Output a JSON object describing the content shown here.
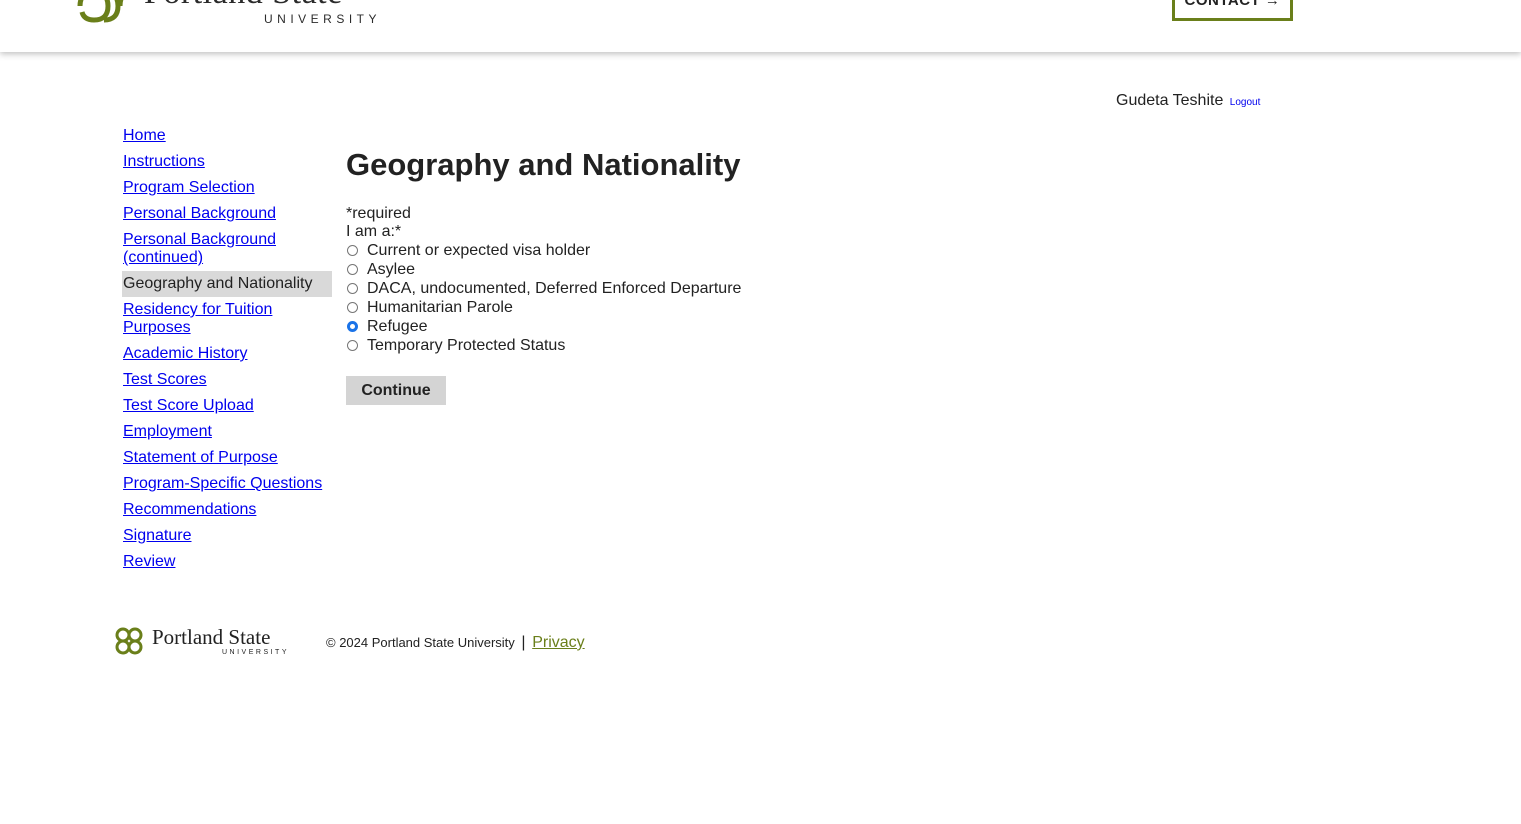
{
  "header": {
    "logo_name": "Portland State",
    "logo_sub": "UNIVERSITY",
    "contact_label": "CONTACT →"
  },
  "user": {
    "name": "Gudeta Teshite",
    "logout_label": "Logout"
  },
  "sidenav": {
    "items": [
      {
        "label": "Home"
      },
      {
        "label": "Instructions"
      },
      {
        "label": "Program Selection"
      },
      {
        "label": "Personal Background"
      },
      {
        "label": "Personal Background (continued)"
      },
      {
        "label": "Geography and Nationality",
        "current": true
      },
      {
        "label": "Residency for Tuition Purposes"
      },
      {
        "label": "Academic History"
      },
      {
        "label": "Test Scores"
      },
      {
        "label": "Test Score Upload"
      },
      {
        "label": "Employment"
      },
      {
        "label": "Statement of Purpose"
      },
      {
        "label": "Program-Specific Questions"
      },
      {
        "label": "Recommendations"
      },
      {
        "label": "Signature"
      },
      {
        "label": "Review"
      }
    ]
  },
  "main": {
    "title": "Geography and Nationality",
    "required_note": "*required",
    "question_label": "I am a:*",
    "options": [
      {
        "label": "Current or expected visa holder",
        "checked": false
      },
      {
        "label": "Asylee",
        "checked": false
      },
      {
        "label": "DACA, undocumented, Deferred Enforced Departure",
        "checked": false
      },
      {
        "label": "Humanitarian Parole",
        "checked": false
      },
      {
        "label": "Refugee",
        "checked": true
      },
      {
        "label": "Temporary Protected Status",
        "checked": false
      }
    ],
    "continue_label": "Continue"
  },
  "footer": {
    "logo_name": "Portland State",
    "logo_sub": "UNIVERSITY",
    "copyright": "© 2024 Portland State University",
    "separator": "|",
    "privacy_label": "Privacy"
  },
  "colors": {
    "brand_green": "#6a7f1a",
    "link_blue": "#0000ee",
    "radio_checked": "#1a73e8"
  }
}
